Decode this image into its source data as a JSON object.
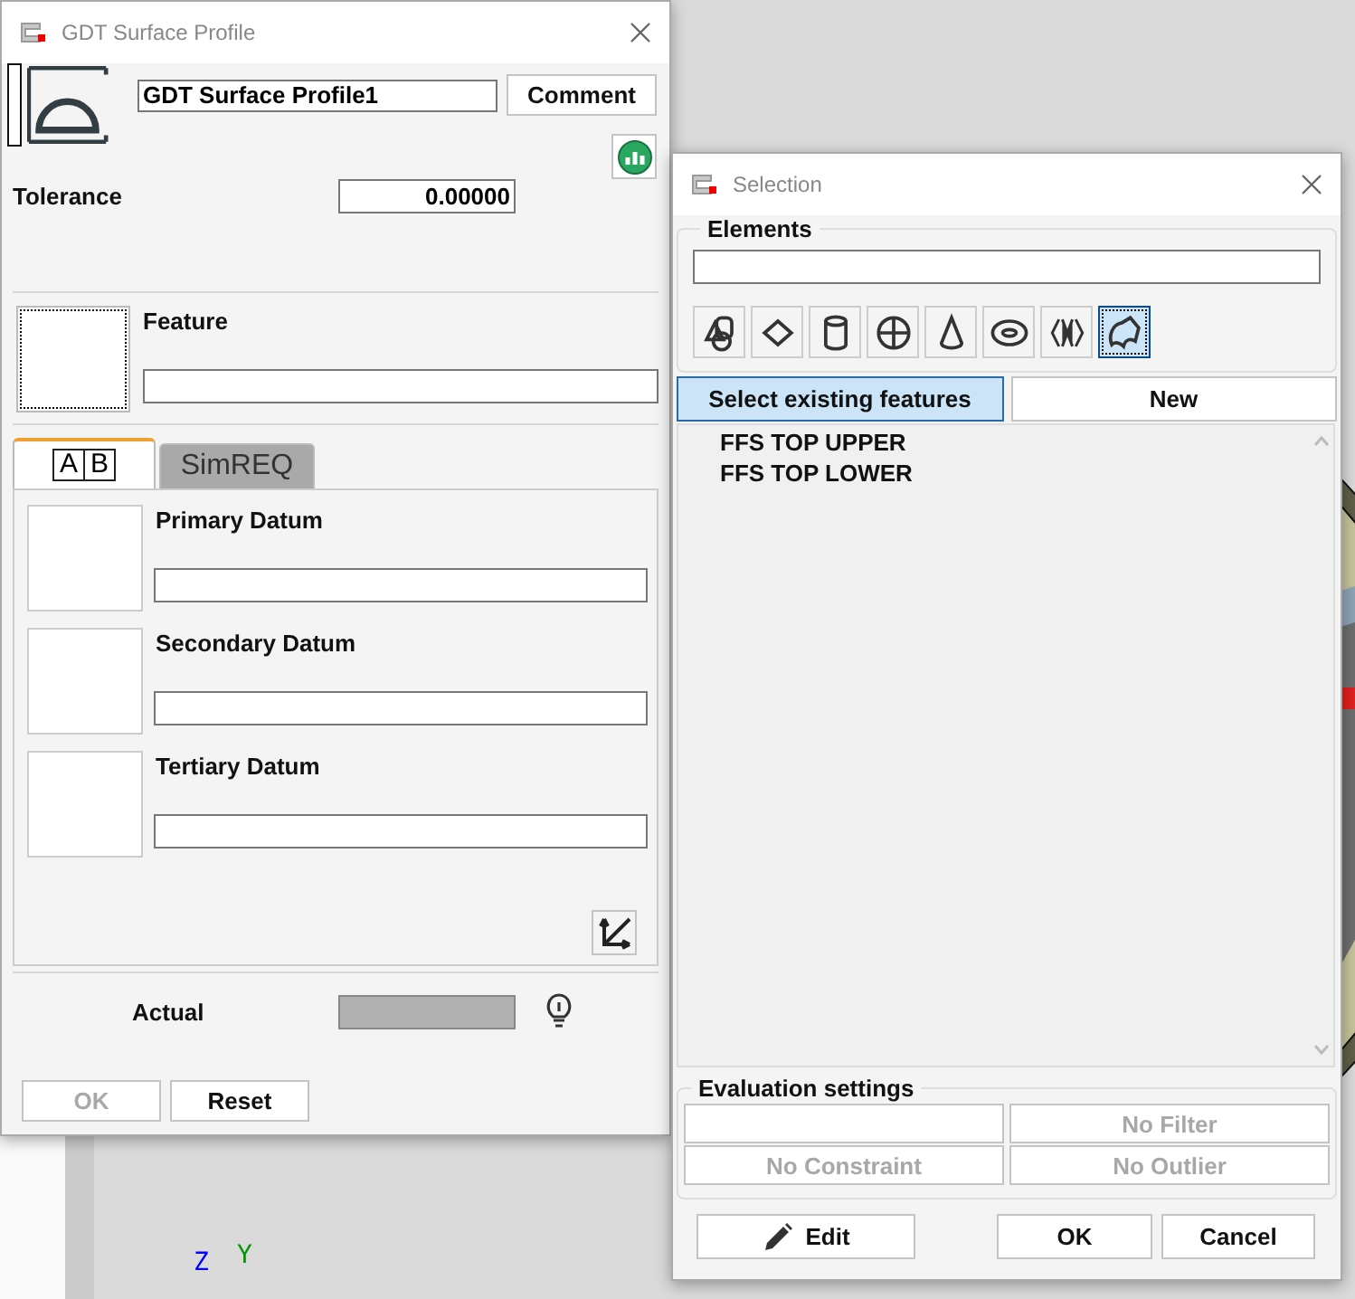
{
  "viewport": {
    "axes": [
      {
        "label": "Z",
        "color": "#0000ff"
      },
      {
        "label": "Y",
        "color": "#009900"
      }
    ]
  },
  "main_dialog": {
    "title": "GDT Surface Profile",
    "name_value": "GDT Surface Profile1",
    "comment_button": "Comment",
    "tolerance_label": "Tolerance",
    "tolerance_value": "0.00000",
    "feature_label": "Feature",
    "tabs": [
      {
        "kind": "datum-frame",
        "letters": [
          "A",
          "B"
        ],
        "selected": true
      },
      {
        "kind": "text",
        "label": "SimREQ",
        "selected": false
      }
    ],
    "datums": [
      "Primary Datum",
      "Secondary Datum",
      "Tertiary Datum"
    ],
    "actual_label": "Actual",
    "buttons": [
      {
        "label": "OK",
        "disabled": true
      },
      {
        "label": "Reset",
        "disabled": false
      }
    ]
  },
  "selection_dialog": {
    "title": "Selection",
    "elements_label": "Elements",
    "element_types": [
      {
        "kind": "solid",
        "selected": false
      },
      {
        "kind": "plane",
        "selected": false
      },
      {
        "kind": "cylinder",
        "selected": false
      },
      {
        "kind": "sphere",
        "selected": false
      },
      {
        "kind": "cone",
        "selected": false
      },
      {
        "kind": "torus",
        "selected": false
      },
      {
        "kind": "symmetry",
        "selected": false
      },
      {
        "kind": "surface",
        "selected": true
      }
    ],
    "modes": [
      {
        "label": "Select existing features",
        "selected": true
      },
      {
        "label": "New",
        "selected": false
      }
    ],
    "features": [
      "FFS TOP UPPER",
      "FFS TOP LOWER"
    ],
    "evaluation_label": "Evaluation settings",
    "settings": [
      {
        "kind": "blank"
      },
      {
        "kind": "text",
        "label": "No Filter",
        "disabled": true
      },
      {
        "kind": "text",
        "label": "No Constraint",
        "disabled": true
      },
      {
        "kind": "text",
        "label": "No Outlier",
        "disabled": true
      }
    ],
    "buttons": [
      {
        "kind": "edit",
        "label": "Edit"
      },
      {
        "kind": "plain",
        "label": "OK"
      },
      {
        "kind": "plain",
        "label": "Cancel"
      }
    ]
  }
}
